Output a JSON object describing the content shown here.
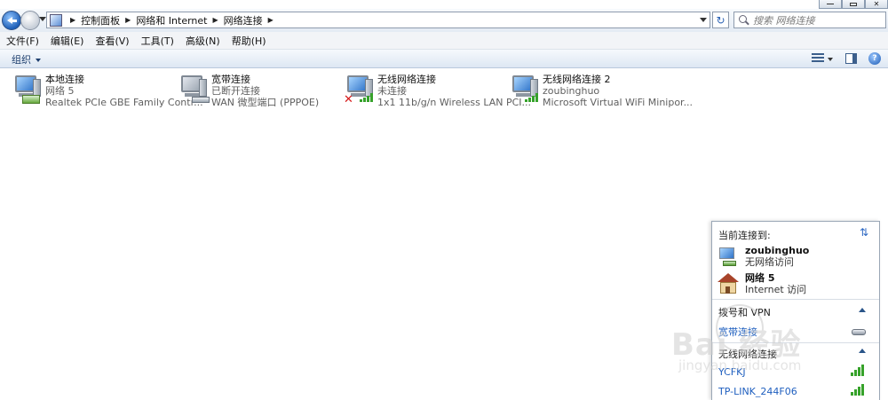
{
  "address_bar": {
    "breadcrumbs": [
      "控制面板",
      "网络和 Internet",
      "网络连接"
    ],
    "search_placeholder": "搜索 网络连接"
  },
  "menu": [
    "文件(F)",
    "编辑(E)",
    "查看(V)",
    "工具(T)",
    "高级(N)",
    "帮助(H)"
  ],
  "command_bar": {
    "organize": "组织"
  },
  "connections": [
    {
      "name": "本地连接",
      "status": "网络  5",
      "device": "Realtek PCIe GBE Family Contr...",
      "icon": "ethernet-icon"
    },
    {
      "name": "宽带连接",
      "status": "已断开连接",
      "device": "WAN 微型端口 (PPPOE)",
      "icon": "modem-icon"
    },
    {
      "name": "无线网络连接",
      "status": "未连接",
      "device": "1x1 11b/g/n Wireless LAN PCI...",
      "icon": "wifi-disconnected-icon"
    },
    {
      "name": "无线网络连接 2",
      "status": "zoubinghuo",
      "device": "Microsoft Virtual WiFi Minipor...",
      "icon": "wifi-icon"
    }
  ],
  "flyout": {
    "header": "当前连接到:",
    "current": [
      {
        "name": "zoubinghuo",
        "access": "无网络访问"
      },
      {
        "name": "网络  5",
        "access": "Internet 访问"
      }
    ],
    "dialup_section": "拨号和 VPN",
    "dialup_items": [
      "宽带连接"
    ],
    "wireless_section": "无线网络连接",
    "wireless_items": [
      "YCFKJ",
      "TP-LINK_244F06"
    ]
  },
  "watermark": {
    "brand": "Bai 经验",
    "site": "jingyan.baidu.com"
  },
  "colors": {
    "link": "#1f5fbf",
    "signal": "#36a22a",
    "error": "#d61b1b"
  }
}
